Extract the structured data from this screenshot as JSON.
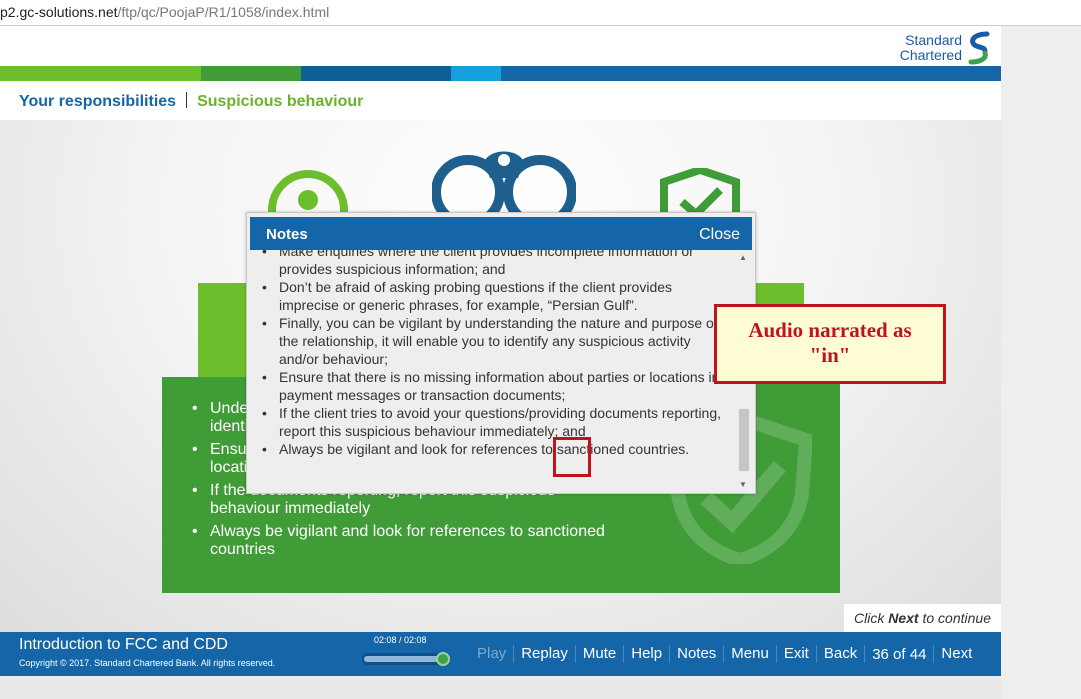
{
  "browser": {
    "url_host": "p2.gc-solutions.net",
    "url_path": "/ftp/qc/PoojaP/R1/1058/index.html"
  },
  "brand": {
    "line1": "Standard",
    "line2": "Chartered"
  },
  "breadcrumb": {
    "section": "Your responsibilities",
    "page": "Suspicious behaviour"
  },
  "colors": {
    "blue": "#1566a8",
    "green_light": "#6dbe2d",
    "green_dark": "#3f9c36",
    "accent_red": "#c0141c"
  },
  "panel_bullets": [
    "Unde",
    "Ensu",
    "If the",
    "Always be vigilant and look for references to sanctioned countries"
  ],
  "panel_bullet_tails": [
    "identi",
    "locati"
  ],
  "panel_bullet3_rest": "documents reporting, report this suspicious behaviour immediately",
  "notes": {
    "title": "Notes",
    "close_label": "Close",
    "items": [
      "Make enquiries where the client provides incomplete information or provides suspicious information; and",
      "Don’t be afraid of asking probing questions if the client provides imprecise or generic phrases, for example, “Persian Gulf”.",
      "Finally, you can be vigilant by understanding the nature and purpose of the relationship, it will enable you to identify any suspicious activity and/or behaviour;",
      "Ensure that there is no missing information about parties or locations in payment messages or transaction documents;",
      "If the client tries to avoid your questions/providing documents reporting, report this suspicious behaviour immediately; and",
      "Always be vigilant and look for references to sanctioned countries."
    ]
  },
  "annotation": {
    "line1": "Audio narrated as",
    "line2": "\"in\""
  },
  "click_next": {
    "prefix": "Click",
    "bold": "Next",
    "suffix": "to continue"
  },
  "player": {
    "course_title": "Introduction to FCC and CDD",
    "copyright": "Copyright © 2017. Standard Chartered Bank. All rights reserved.",
    "time": "02:08 / 02:08",
    "progress": 1.0,
    "buttons": [
      "Play",
      "Replay",
      "Mute",
      "Help",
      "Notes",
      "Menu",
      "Exit",
      "Back"
    ],
    "page_indicator": "36 of 44",
    "next_label": "Next"
  }
}
